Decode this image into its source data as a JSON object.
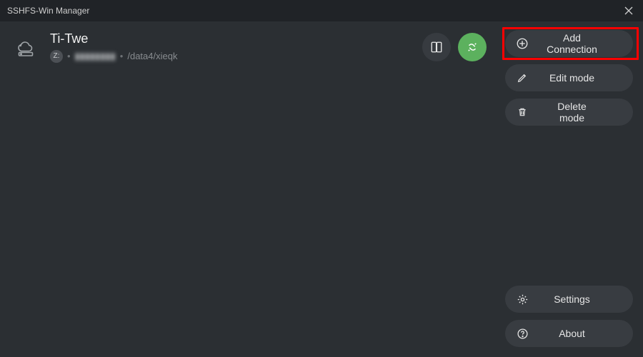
{
  "window": {
    "title": "SSHFS-Win Manager"
  },
  "connection": {
    "name": "Ti-Twe",
    "drive_letter": "Z:",
    "host_blurred": "▮▮▮▮▮▮▮▮",
    "path": "/data4/xieqk"
  },
  "sidebar": {
    "add_connection": "Add Connection",
    "edit_mode": "Edit mode",
    "delete_mode": "Delete mode",
    "settings": "Settings",
    "about": "About"
  }
}
